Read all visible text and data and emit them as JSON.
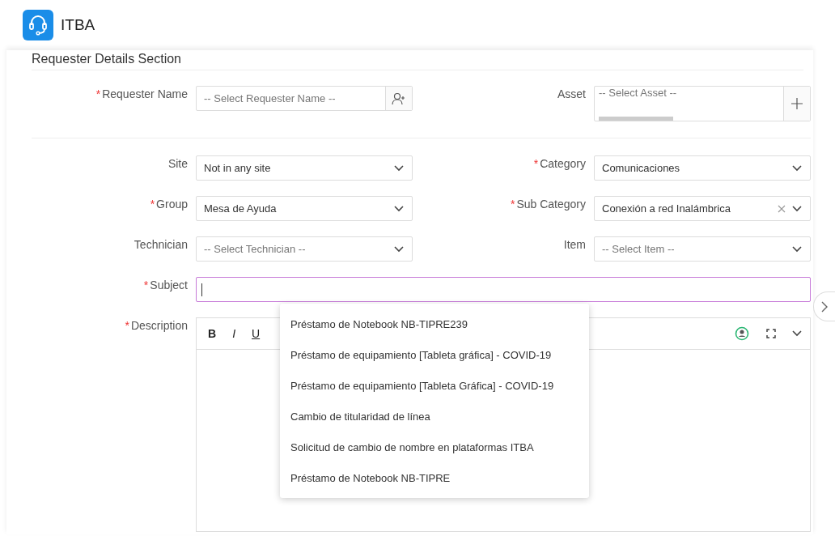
{
  "header": {
    "title": "ITBA"
  },
  "required_mark": "*",
  "section": {
    "title": "Requester Details Section"
  },
  "top_row": [
    {
      "kind": "lookup",
      "label": "Requester Name",
      "required": true,
      "placeholder": "-- Select Requester Name --"
    },
    {
      "kind": "asset",
      "label": "Asset",
      "required": false,
      "placeholder": "-- Select Asset --"
    }
  ],
  "rows": [
    {
      "kind": "select",
      "label": "Site",
      "required": false,
      "value": "Not in any site",
      "clearable": false
    },
    {
      "kind": "select",
      "label": "Category",
      "required": true,
      "value": "Comunicaciones",
      "clearable": false
    },
    {
      "kind": "select",
      "label": "Group",
      "required": true,
      "value": "Mesa de Ayuda",
      "clearable": false
    },
    {
      "kind": "select",
      "label": "Sub Category",
      "required": true,
      "value": "Conexión a red Inalámbrica",
      "clearable": true
    },
    {
      "kind": "select",
      "label": "Technician",
      "required": false,
      "placeholder": "-- Select Technician --",
      "clearable": false
    },
    {
      "kind": "select",
      "label": "Item",
      "required": false,
      "placeholder": "-- Select Item --",
      "clearable": false
    }
  ],
  "subject": {
    "label": "Subject",
    "required": true,
    "focused": true
  },
  "description": {
    "label": "Description",
    "required": true,
    "toolbar": [
      "B",
      "I",
      "U"
    ]
  },
  "suggestions": [
    {
      "text": "Préstamo de Notebook NB-TIPRE239"
    },
    {
      "text": "Préstamo de equipamiento [Tableta gráfica] - COVID-19"
    },
    {
      "text": "Préstamo de equipamiento [Tableta Gráfica] - COVID-19"
    },
    {
      "text": "Cambio de titularidad de línea"
    },
    {
      "text": "Solicitud de cambio de nombre en plataformas ITBA"
    },
    {
      "text": "Préstamo de Notebook NB-TIPRE"
    }
  ]
}
